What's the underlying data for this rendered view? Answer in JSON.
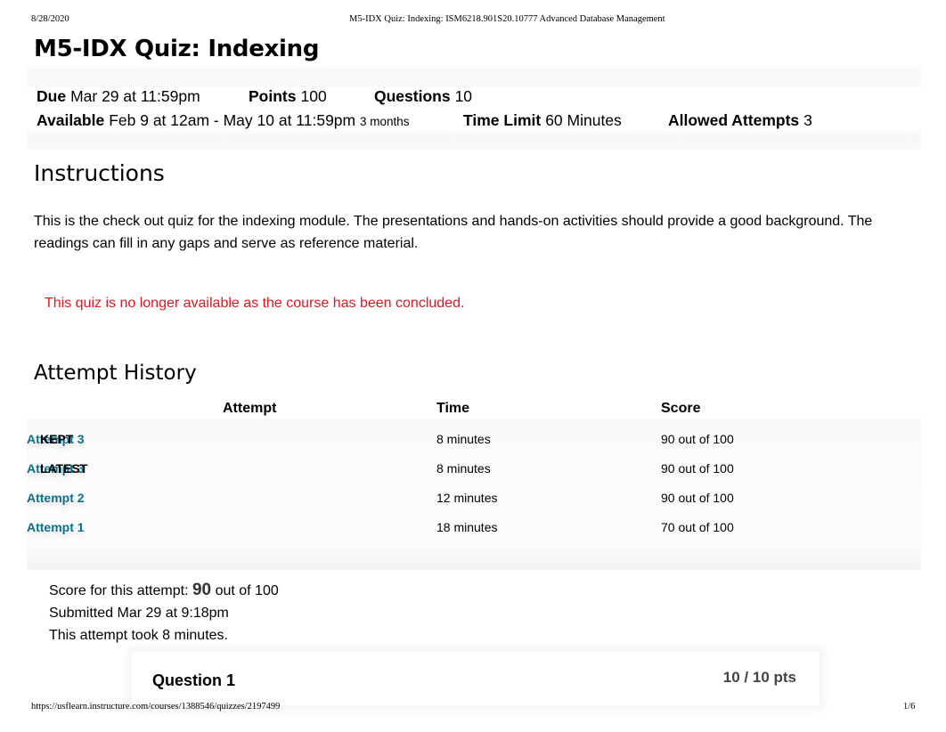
{
  "print_header": {
    "date": "8/28/2020",
    "title": "M5-IDX Quiz: Indexing: ISM6218.901S20.10777 Advanced Database Management"
  },
  "quiz": {
    "title": "M5-IDX Quiz: Indexing",
    "meta": {
      "due_label": "Due",
      "due_value": "Mar 29 at 11:59pm",
      "points_label": "Points",
      "points_value": "100",
      "questions_label": "Questions",
      "questions_value": "10",
      "available_label": "Available",
      "available_value": "Feb 9 at 12am - May 10 at 11:59pm",
      "available_duration": "3 months",
      "time_limit_label": "Time Limit",
      "time_limit_value": "60 Minutes",
      "attempts_label": "Allowed Attempts",
      "attempts_value": "3"
    }
  },
  "instructions": {
    "heading": "Instructions",
    "text": "This is the check out quiz for the indexing module.  The presentations and hands-on activities should provide a good background.  The readings can fill in any gaps and serve as reference material.",
    "notice": "This quiz is no longer available as the course has been concluded."
  },
  "attempt_history": {
    "heading": "Attempt History",
    "columns": [
      "",
      "Attempt",
      "Time",
      "Score"
    ],
    "rows": [
      {
        "label": "KEPT",
        "attempt": "Attempt 3",
        "time": "8 minutes",
        "score": "90 out of 100"
      },
      {
        "label": "LATEST",
        "attempt": "Attempt 3",
        "time": "8 minutes",
        "score": "90 out of 100"
      },
      {
        "label": "",
        "attempt": "Attempt 2",
        "time": "12 minutes",
        "score": "90 out of 100"
      },
      {
        "label": "",
        "attempt": "Attempt 1",
        "time": "18 minutes",
        "score": "70 out of 100"
      }
    ]
  },
  "summary": {
    "score_prefix": "Score for this attempt:",
    "score_value": "90",
    "score_suffix": "out of 100",
    "submitted": "Submitted Mar 29 at 9:18pm",
    "duration": "This attempt took 8 minutes."
  },
  "question": {
    "title": "Question 1",
    "points": "10 / 10 pts"
  },
  "print_footer": {
    "url": "https://usflearn.instructure.com/courses/1388546/quizzes/2197499",
    "page": "1/6"
  },
  "colors": {
    "link": "#0e6f8b",
    "notice": "#e0161e"
  }
}
